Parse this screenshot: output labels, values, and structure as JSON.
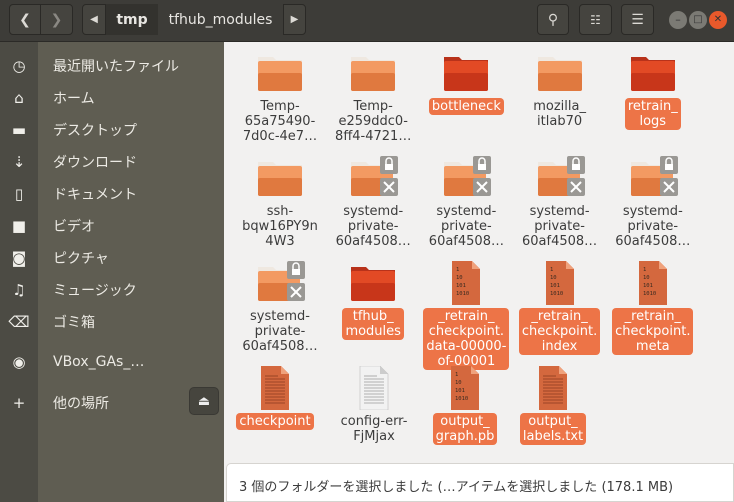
{
  "header": {
    "path": [
      "tmp",
      "tfhub_modules"
    ]
  },
  "sidebar": {
    "items": [
      {
        "label": "最近開いたファイル",
        "icon": "clock-icon",
        "g": "◷"
      },
      {
        "label": "ホーム",
        "icon": "home-icon",
        "g": "⌂"
      },
      {
        "label": "デスクトップ",
        "icon": "folder-icon",
        "g": "▬"
      },
      {
        "label": "ダウンロード",
        "icon": "download-icon",
        "g": "⇣"
      },
      {
        "label": "ドキュメント",
        "icon": "document-icon",
        "g": "▯"
      },
      {
        "label": "ビデオ",
        "icon": "video-icon",
        "g": "■"
      },
      {
        "label": "ピクチャ",
        "icon": "camera-icon",
        "g": "◙"
      },
      {
        "label": "ミュージック",
        "icon": "music-icon",
        "g": "♫"
      },
      {
        "label": "ゴミ箱",
        "icon": "trash-icon",
        "g": "⌫"
      },
      {
        "label": "VBox_GAs_…",
        "icon": "disc-icon",
        "g": "◉"
      },
      {
        "label": "他の場所",
        "icon": "plus-icon",
        "g": "+"
      }
    ]
  },
  "files": [
    {
      "name": "Temp-\n65a75490-\n7d0c-4e7…",
      "type": "folder",
      "selected": false
    },
    {
      "name": "Temp-\ne259ddc0-\n8ff4-4721…",
      "type": "folder",
      "selected": false
    },
    {
      "name": "bottleneck",
      "type": "folder",
      "selected": true
    },
    {
      "name": "mozilla_\nitlab70",
      "type": "folder",
      "selected": false
    },
    {
      "name": "retrain_\nlogs",
      "type": "folder",
      "selected": true
    },
    {
      "name": "ssh-\nbqw16PY9n\n4W3",
      "type": "folder",
      "selected": false
    },
    {
      "name": "systemd-\nprivate-\n60af4508…",
      "type": "locked",
      "selected": false
    },
    {
      "name": "systemd-\nprivate-\n60af4508…",
      "type": "locked",
      "selected": false
    },
    {
      "name": "systemd-\nprivate-\n60af4508…",
      "type": "locked",
      "selected": false
    },
    {
      "name": "systemd-\nprivate-\n60af4508…",
      "type": "locked",
      "selected": false
    },
    {
      "name": "systemd-\nprivate-\n60af4508…",
      "type": "locked",
      "selected": false
    },
    {
      "name": "tfhub_\nmodules",
      "type": "folder",
      "selected": true
    },
    {
      "name": "_retrain_\ncheckpoint.\ndata-00000-\nof-00001",
      "type": "binary",
      "selected": true
    },
    {
      "name": "_retrain_\ncheckpoint.\nindex",
      "type": "binary",
      "selected": true
    },
    {
      "name": "_retrain_\ncheckpoint.\nmeta",
      "type": "binary",
      "selected": true
    },
    {
      "name": "checkpoint",
      "type": "text",
      "selected": true
    },
    {
      "name": "config-err-\nFjMjax",
      "type": "plain",
      "selected": false
    },
    {
      "name": "output_\ngraph.pb",
      "type": "binary",
      "selected": true
    },
    {
      "name": "output_\nlabels.txt",
      "type": "text",
      "selected": true
    }
  ],
  "status": "3 個のフォルダーを選択しました (…アイテムを選択しました (178.1 MB)"
}
